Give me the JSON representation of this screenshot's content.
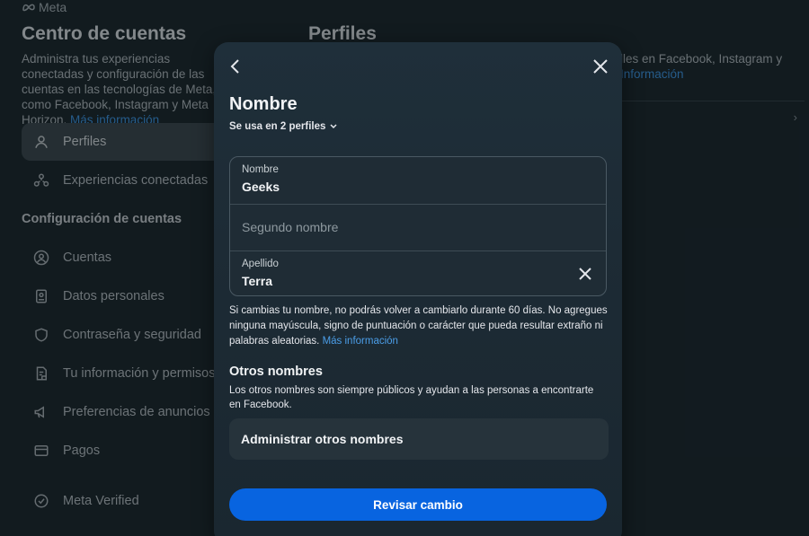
{
  "brand": {
    "name": "Meta"
  },
  "sidebar": {
    "title": "Centro de cuentas",
    "description": "Administra tus experiencias conectadas y configuración de las cuentas en las tecnologías de Meta, como Facebook, Instagram y Meta Horizon.",
    "description_link": "Más información",
    "primary_items": [
      {
        "label": "Perfiles",
        "icon": "person-icon",
        "active": true
      },
      {
        "label": "Experiencias conectadas",
        "icon": "connected-icon",
        "active": false
      }
    ],
    "section_heading": "Configuración de cuentas",
    "settings_items": [
      {
        "label": "Cuentas",
        "icon": "account-circle-icon"
      },
      {
        "label": "Datos personales",
        "icon": "id-card-icon"
      },
      {
        "label": "Contraseña y seguridad",
        "icon": "shield-icon"
      },
      {
        "label": "Tu información y permisos",
        "icon": "document-lock-icon"
      },
      {
        "label": "Preferencias de anuncios",
        "icon": "megaphone-icon"
      },
      {
        "label": "Pagos",
        "icon": "credit-card-icon"
      },
      {
        "label": "Meta Verified",
        "icon": "verified-badge-icon"
      }
    ]
  },
  "main": {
    "title": "Perfiles",
    "description": "lles en Facebook, Instagram y",
    "description_link": "Información"
  },
  "modal": {
    "title": "Nombre",
    "usage_label": "Se usa en 2 perfiles",
    "fields": {
      "first_name": {
        "label": "Nombre",
        "value": "Geeks"
      },
      "middle_name": {
        "placeholder": "Segundo nombre",
        "value": ""
      },
      "last_name": {
        "label": "Apellido",
        "value": "Terra"
      }
    },
    "notice": "Si cambias tu nombre, no podrás volver a cambiarlo durante 60 días. No agregues ninguna mayúscula, signo de puntuación o carácter que pueda resultar extraño ni palabras aleatorias.",
    "notice_link": "Más información",
    "other_names": {
      "heading": "Otros nombres",
      "description": "Los otros nombres son siempre públicos y ayudan a las personas a encontrarte en Facebook.",
      "manage_label": "Administrar otros nombres"
    },
    "review_button": "Revisar cambio"
  },
  "colors": {
    "primary_button": "#0864e0",
    "link": "#4b9ee8",
    "modal_bg": "#1f2f3a",
    "page_bg": "#1c2a31"
  }
}
